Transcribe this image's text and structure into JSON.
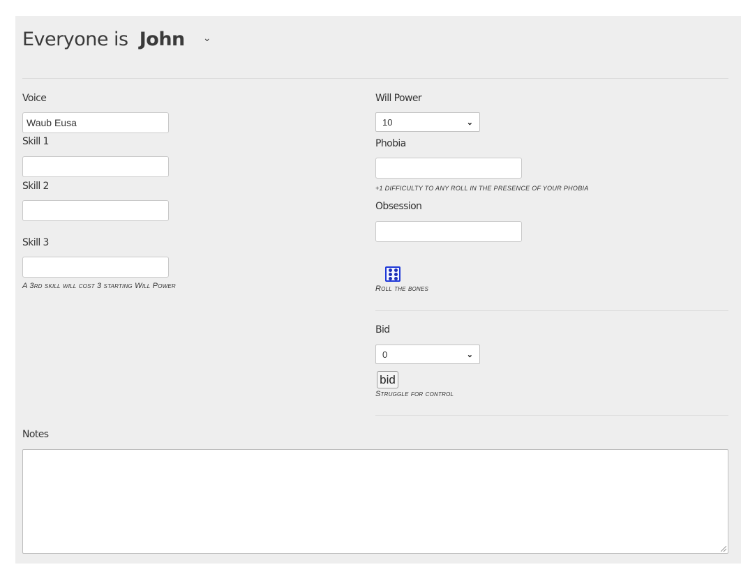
{
  "header": {
    "title_prefix": "Everyone is",
    "character_name": "John",
    "chevron": "chevron-down-icon"
  },
  "left": {
    "voice_label": "Voice",
    "voice_value": "Waub Eusa",
    "skill1_label": "Skill 1",
    "skill1_value": "",
    "skill2_label": "Skill 2",
    "skill2_value": "",
    "skill3_label": "Skill 3",
    "skill3_value": "",
    "skill3_hint": "A 3rd skill will cost 3 starting Will Power"
  },
  "right": {
    "willpower_label": "Will Power",
    "willpower_value": "10",
    "phobia_label": "Phobia",
    "phobia_value": "",
    "phobia_hint": "+1 difficulty to any roll in the presence of your phobia",
    "obsession_label": "Obsession",
    "obsession_value": "",
    "dice_icon": "dice-six-icon",
    "roll_hint": "Roll the bones",
    "bid_label": "Bid",
    "bid_value": "0",
    "bid_button": "bid",
    "bid_hint": "Struggle for control"
  },
  "notes": {
    "label": "Notes",
    "value": ""
  },
  "colors": {
    "panel_bg": "#eeeeee",
    "dice_accent": "#1e38d8"
  }
}
